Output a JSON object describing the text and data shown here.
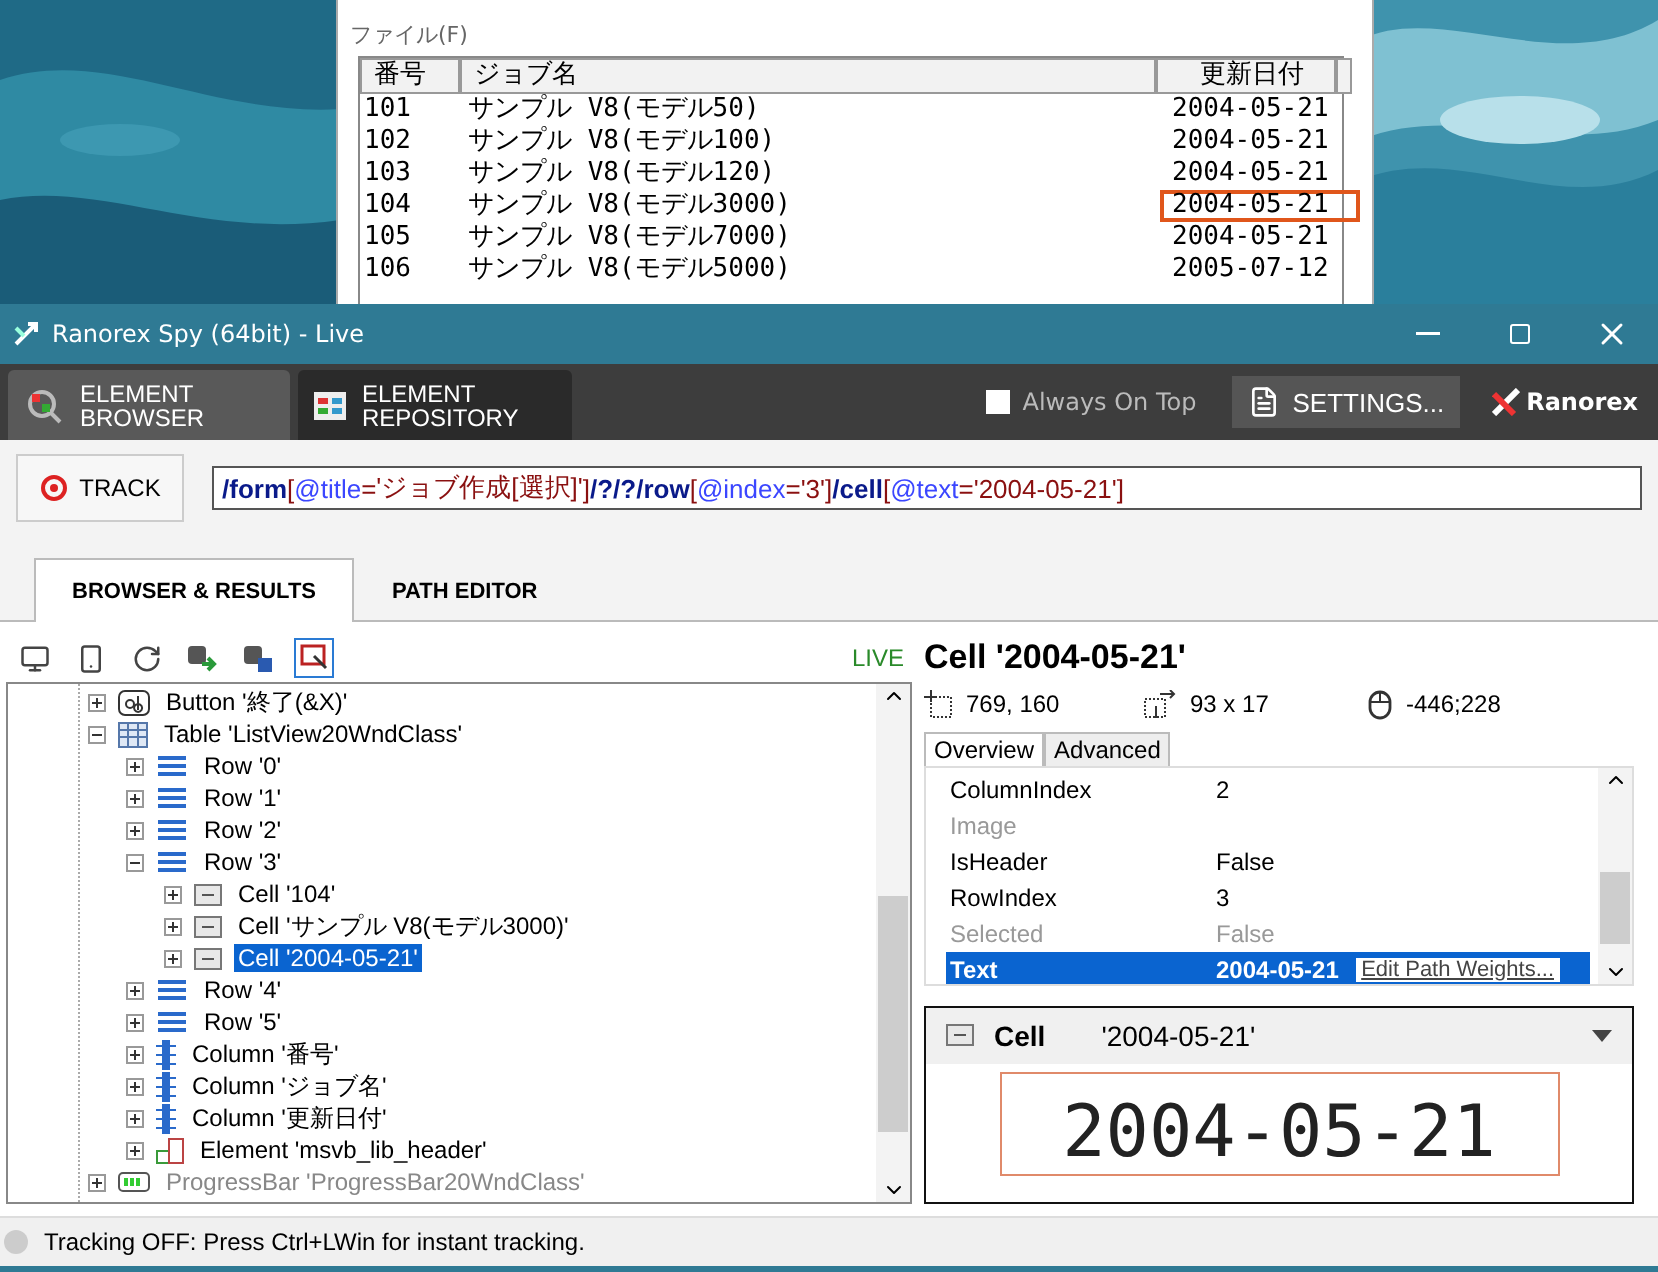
{
  "background_app": {
    "menu": "ファイル(F)",
    "columns": [
      "番号",
      "ジョブ名",
      "更新日付"
    ],
    "rows": [
      {
        "cells": [
          "101",
          "サンプル V8(モデル50)",
          "2004-05-21"
        ],
        "highlighted": false
      },
      {
        "cells": [
          "102",
          "サンプル V8(モデル100)",
          "2004-05-21"
        ],
        "highlighted": false
      },
      {
        "cells": [
          "103",
          "サンプル V8(モデル120)",
          "2004-05-21"
        ],
        "highlighted": false
      },
      {
        "cells": [
          "104",
          "サンプル V8(モデル3000)",
          "2004-05-21"
        ],
        "highlighted": true
      },
      {
        "cells": [
          "105",
          "サンプル V8(モデル7000)",
          "2004-05-21"
        ],
        "highlighted": false
      },
      {
        "cells": [
          "106",
          "サンプル V8(モデル5000)",
          "2005-07-12"
        ],
        "highlighted": false
      }
    ]
  },
  "window": {
    "title": "Ranorex Spy (64bit) - Live"
  },
  "main_tabs": [
    {
      "label": "ELEMENT BROWSER",
      "selected": true
    },
    {
      "label": "ELEMENT REPOSITORY",
      "selected": false
    }
  ],
  "always_on_top": {
    "label": "Always On Top",
    "checked": false
  },
  "settings_button": "SETTINGS...",
  "brand": "Ranorex",
  "track_button": "TRACK",
  "path": [
    {
      "kind": "sep",
      "text": "/"
    },
    {
      "kind": "tag",
      "text": "form"
    },
    {
      "kind": "bracket",
      "text": "["
    },
    {
      "kind": "attr",
      "text": "@title"
    },
    {
      "kind": "bracket",
      "text": "="
    },
    {
      "kind": "value",
      "text": "'ジョブ作成[選択]'"
    },
    {
      "kind": "bracket",
      "text": "]"
    },
    {
      "kind": "sep",
      "text": "/?/?/"
    },
    {
      "kind": "tag",
      "text": "row"
    },
    {
      "kind": "bracket",
      "text": "["
    },
    {
      "kind": "attr",
      "text": "@index"
    },
    {
      "kind": "bracket",
      "text": "="
    },
    {
      "kind": "value",
      "text": "'3'"
    },
    {
      "kind": "bracket",
      "text": "]"
    },
    {
      "kind": "sep",
      "text": "/"
    },
    {
      "kind": "tag",
      "text": "cell"
    },
    {
      "kind": "bracket",
      "text": "["
    },
    {
      "kind": "attr",
      "text": "@text"
    },
    {
      "kind": "bracket",
      "text": "="
    },
    {
      "kind": "value",
      "text": "'2004-05-21'"
    },
    {
      "kind": "bracket",
      "text": "]"
    }
  ],
  "view_tabs": [
    {
      "label": "BROWSER & RESULTS",
      "selected": true
    },
    {
      "label": "PATH EDITOR",
      "selected": false
    }
  ],
  "live_label": "LIVE",
  "tree": [
    {
      "kind": "button",
      "label": "Button '終了(&X)'",
      "expanded": false,
      "selected": false,
      "disabled": false
    },
    {
      "kind": "table",
      "label": "Table 'ListView20WndClass'",
      "expanded": true,
      "selected": false,
      "disabled": false,
      "children": [
        {
          "kind": "row",
          "label": "Row '0'",
          "expanded": false,
          "selected": false,
          "disabled": false
        },
        {
          "kind": "row",
          "label": "Row '1'",
          "expanded": false,
          "selected": false,
          "disabled": false
        },
        {
          "kind": "row",
          "label": "Row '2'",
          "expanded": false,
          "selected": false,
          "disabled": false
        },
        {
          "kind": "row",
          "label": "Row '3'",
          "expanded": true,
          "selected": false,
          "disabled": false,
          "children": [
            {
              "kind": "cell",
              "label": "Cell '104'",
              "expanded": false,
              "selected": false,
              "disabled": false
            },
            {
              "kind": "cell",
              "label": "Cell 'サンプル V8(モデル3000)'",
              "expanded": false,
              "selected": false,
              "disabled": false
            },
            {
              "kind": "cell",
              "label": "Cell '2004-05-21'",
              "expanded": false,
              "selected": true,
              "disabled": false
            }
          ]
        },
        {
          "kind": "row",
          "label": "Row '4'",
          "expanded": false,
          "selected": false,
          "disabled": false
        },
        {
          "kind": "row",
          "label": "Row '5'",
          "expanded": false,
          "selected": false,
          "disabled": false
        },
        {
          "kind": "column",
          "label": "Column '番号'",
          "expanded": false,
          "selected": false,
          "disabled": false
        },
        {
          "kind": "column",
          "label": "Column 'ジョブ名'",
          "expanded": false,
          "selected": false,
          "disabled": false
        },
        {
          "kind": "column",
          "label": "Column '更新日付'",
          "expanded": false,
          "selected": false,
          "disabled": false
        },
        {
          "kind": "element",
          "label": "Element 'msvb_lib_header'",
          "expanded": false,
          "selected": false,
          "disabled": false
        }
      ]
    },
    {
      "kind": "progressbar",
      "label": "ProgressBar 'ProgressBar20WndClass'",
      "expanded": false,
      "selected": false,
      "disabled": true
    }
  ],
  "details": {
    "title": "Cell '2004-05-21'",
    "location": "769, 160",
    "size": "93 x 17",
    "mouse": "-446;228",
    "tabs": [
      {
        "label": "Overview",
        "selected": true
      },
      {
        "label": "Advanced",
        "selected": false
      }
    ],
    "properties": [
      {
        "name": "ColumnIndex",
        "value": "2",
        "disabled": false,
        "selected": false
      },
      {
        "name": "Image",
        "disabled": true,
        "selected": false
      },
      {
        "name": "IsHeader",
        "value": "False",
        "disabled": false,
        "selected": false
      },
      {
        "name": "RowIndex",
        "value": "3",
        "disabled": false,
        "selected": false
      },
      {
        "name": "Selected",
        "value": "False",
        "disabled": true,
        "selected": false
      },
      {
        "name": "Text",
        "value": "2004-05-21",
        "disabled": false,
        "selected": true
      }
    ],
    "edit_link": "Edit Path Weights..."
  },
  "preview": {
    "type": "Cell",
    "name": "'2004-05-21'",
    "image_text": "2004-05-21"
  },
  "status_bar": {
    "text": "Tracking OFF: Press Ctrl+LWin for instant tracking."
  }
}
